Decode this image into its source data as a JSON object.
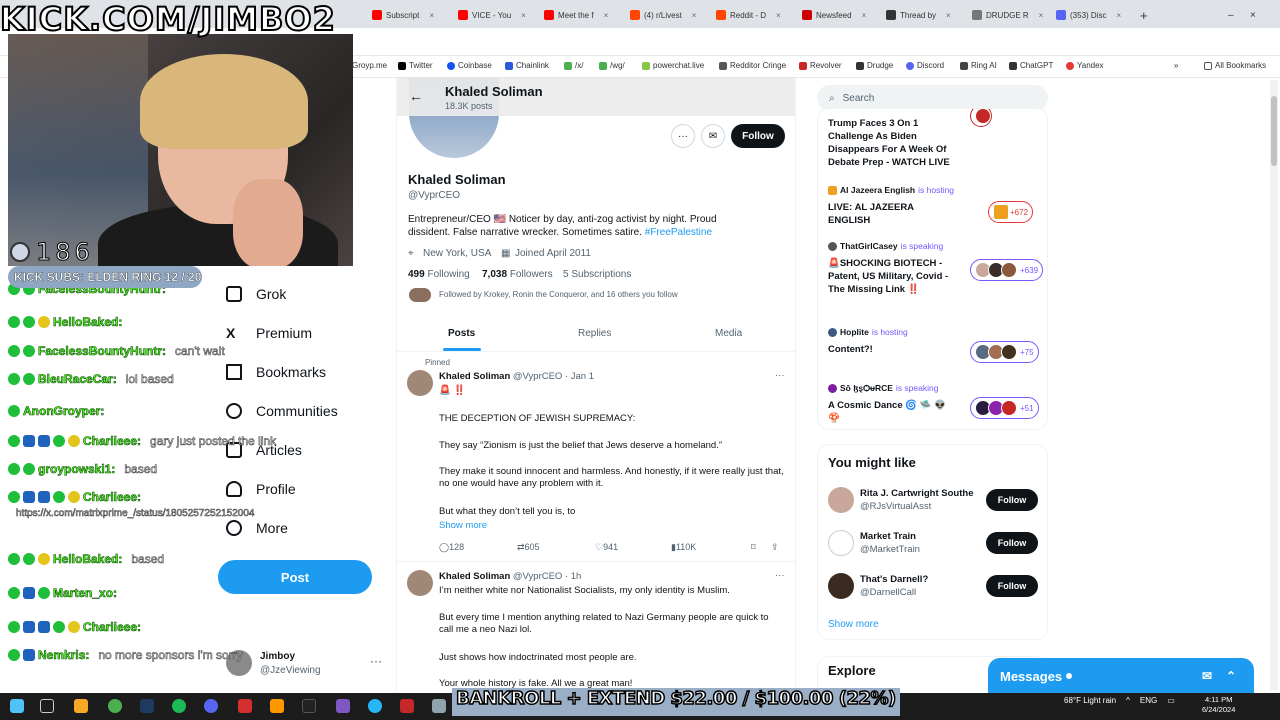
{
  "stream": {
    "title": "KICK.COM/JIMBO2",
    "viewers": "186",
    "subs_goal": "KICK SUBS: ELDEN RING 12 / 20",
    "bankroll": "BANKROLL + EXTEND $22.00 / $100.00 (22%)"
  },
  "chat": [
    {
      "user": "FacelessBountyHuntr:",
      "msg": ""
    },
    {
      "user": "HelloBaked:",
      "msg": ""
    },
    {
      "user": "FacelessBountyHuntr:",
      "msg": "can't wait"
    },
    {
      "user": "BleuRaceCar:",
      "msg": "lol based"
    },
    {
      "user": "AnonGroyper:",
      "msg": ""
    },
    {
      "user": "Charlieee:",
      "msg": "gary just posted the link"
    },
    {
      "user": "groypowski1:",
      "msg": "based"
    },
    {
      "user": "Charlieee:",
      "msg": ""
    },
    {
      "user": "",
      "msg": "https://x.com/matrixprime_/status/1805257252152004"
    },
    {
      "user": "HelloBaked:",
      "msg": "based"
    },
    {
      "user": "Marten_xo:",
      "msg": ""
    },
    {
      "user": "Charlieee:",
      "msg": ""
    },
    {
      "user": "Nemkris:",
      "msg": "no more sponsors i'm sorry"
    }
  ],
  "tabs": [
    {
      "label": "Subscript",
      "color": "#ff0000"
    },
    {
      "label": "VICE - You",
      "color": "#ff0000"
    },
    {
      "label": "Meet the f",
      "color": "#ff0000"
    },
    {
      "label": "(4) r/Livest",
      "color": "#ff4500"
    },
    {
      "label": "Reddit - D",
      "color": "#ff4500"
    },
    {
      "label": "Newsfeed",
      "color": "#cc0000"
    },
    {
      "label": "Thread by",
      "color": "#333333"
    },
    {
      "label": "DRUDGE R",
      "color": "#777777"
    },
    {
      "label": "(353) Disc",
      "color": "#5865f2"
    }
  ],
  "bookmarks": [
    "Groyp.me",
    "Twitter",
    "Coinbase",
    "Chainlink",
    "/x/",
    "/wg/",
    "powerchat.live",
    "Redditor Cringe",
    "Revolver",
    "Drudge",
    "Discord",
    "Ring AI",
    "ChatGPT",
    "Yandex",
    "All Bookmarks"
  ],
  "nav": [
    "Grok",
    "Premium",
    "Bookmarks",
    "Communities",
    "Articles",
    "Profile",
    "More"
  ],
  "nav_post": "Post",
  "account": {
    "name": "Jimboy",
    "handle": "@JzeViewing"
  },
  "profile": {
    "header_name": "Khaled Soliman",
    "header_posts": "18.3K posts",
    "name": "Khaled Soliman",
    "handle": "@VyprCEO",
    "bio": "Entrepreneur/CEO 🇺🇸 Noticer by day, anti-zog activist by night. Proud dissident. False narrative wrecker. Sometimes satire.",
    "bio_tag": "#FreePalestine",
    "location": "New York, USA",
    "joined": "Joined April 2011",
    "following_count": "499",
    "following_label": "Following",
    "followers_count": "7,038",
    "followers_label": "Followers",
    "subs": "5 Subscriptions",
    "followed_by": "Followed by Krokey, Ronin the Conqueror, and 16 others you follow",
    "follow_label": "Follow",
    "tabs": [
      "Posts",
      "Replies",
      "Media"
    ]
  },
  "tweets": [
    {
      "pinned": "Pinned",
      "author": "Khaled Soliman",
      "meta": "@VyprCEO · Jan 1",
      "emoji": "🚨 ‼️",
      "lines": [
        "THE DECEPTION OF JEWISH SUPREMACY:",
        "They say “Zionism is just the belief that Jews deserve a homeland.”",
        "They make it sound innocent and harmless. And honestly, if it were really just that, no one would have any problem with it.",
        "But what they don’t tell you is, to"
      ],
      "show_more": "Show more",
      "replies": "128",
      "reposts": "605",
      "likes": "941",
      "views": "110K"
    },
    {
      "author": "Khaled Soliman",
      "meta": "@VyprCEO · 1h",
      "lines": [
        "I’m neither white nor Nationalist Socialists, my only identity is Muslim.",
        "But every time I mention anything related to Nazi Germany people are quick to call me a neo Nazi lol.",
        "Just shows how indoctrinated most people are.",
        "Your whole history is fake. All we a great man!"
      ]
    }
  ],
  "search_placeholder": "Search",
  "spaces": [
    {
      "host": "",
      "status": "",
      "title": "Trump Faces 3 On 1 Challenge As Biden Disappears For A Week Of Debate Prep - WATCH LIVE",
      "count": ""
    },
    {
      "host": "Al Jazeera English",
      "status": "is hosting",
      "title": "LIVE: AL JAZEERA ENGLISH",
      "count": "+672"
    },
    {
      "host": "ThatGirlCasey",
      "status": "is speaking",
      "title": "🚨SHOCKING BIOTECH - Patent, US Military, Covid - The Missing Link ‼️",
      "count": "+639"
    },
    {
      "host": "Hoplite",
      "status": "is hosting",
      "title": "Content?!",
      "count": "+75"
    },
    {
      "host": "Sō ɮȿѺᵾRCE",
      "status": "is speaking",
      "title": "A Cosmic Dance 🌀 🛸 👽 🍄",
      "count": "+51"
    }
  ],
  "who_to_follow": {
    "title": "You might like",
    "items": [
      {
        "name": "Rita J. Cartwright Southe",
        "handle": "@RJsVirtualAsst"
      },
      {
        "name": "Market Train",
        "handle": "@MarketTrain"
      },
      {
        "name": "That's Darnell?",
        "handle": "@DarnellCall"
      }
    ],
    "follow": "Follow",
    "show_more": "Show more"
  },
  "explore": "Explore",
  "messages": "Messages",
  "taskbar": {
    "weather": "68°F Light rain",
    "lang": "ENG",
    "time": "4:11 PM",
    "date": "6/24/2024"
  }
}
